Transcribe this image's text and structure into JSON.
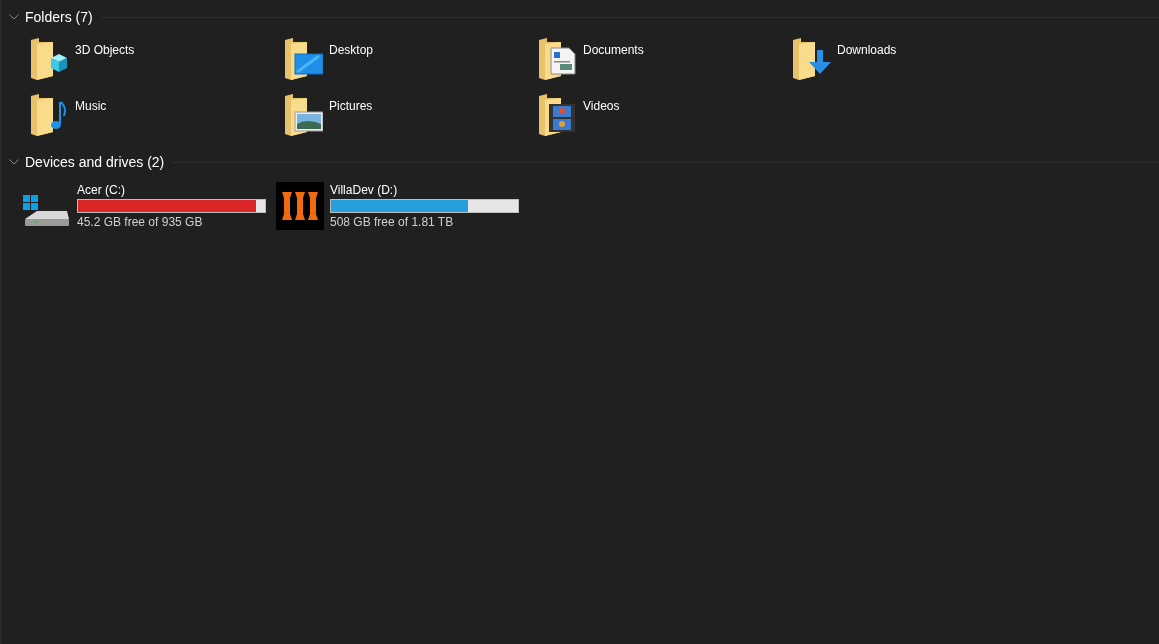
{
  "sections": [
    {
      "kind": "folders",
      "title": "Folders (7)",
      "expanded": true,
      "items": [
        {
          "name": "3D Objects",
          "kind": "cube"
        },
        {
          "name": "Desktop",
          "kind": "desktop"
        },
        {
          "name": "Documents",
          "kind": "document"
        },
        {
          "name": "Downloads",
          "kind": "download"
        },
        {
          "name": "Music",
          "kind": "music"
        },
        {
          "name": "Pictures",
          "kind": "picture"
        },
        {
          "name": "Videos",
          "kind": "video"
        }
      ]
    },
    {
      "kind": "drives",
      "title": "Devices and drives (2)",
      "expanded": true,
      "items": [
        {
          "name": "Acer (C:)",
          "kind": "system",
          "level": 0.95,
          "color": "#da2626",
          "free": "45.2 GB free of 935 GB"
        },
        {
          "name": "VillaDev (D:)",
          "kind": "logo",
          "level": 0.73,
          "color": "#26a0da",
          "free": "508 GB free of 1.81 TB"
        }
      ]
    }
  ]
}
